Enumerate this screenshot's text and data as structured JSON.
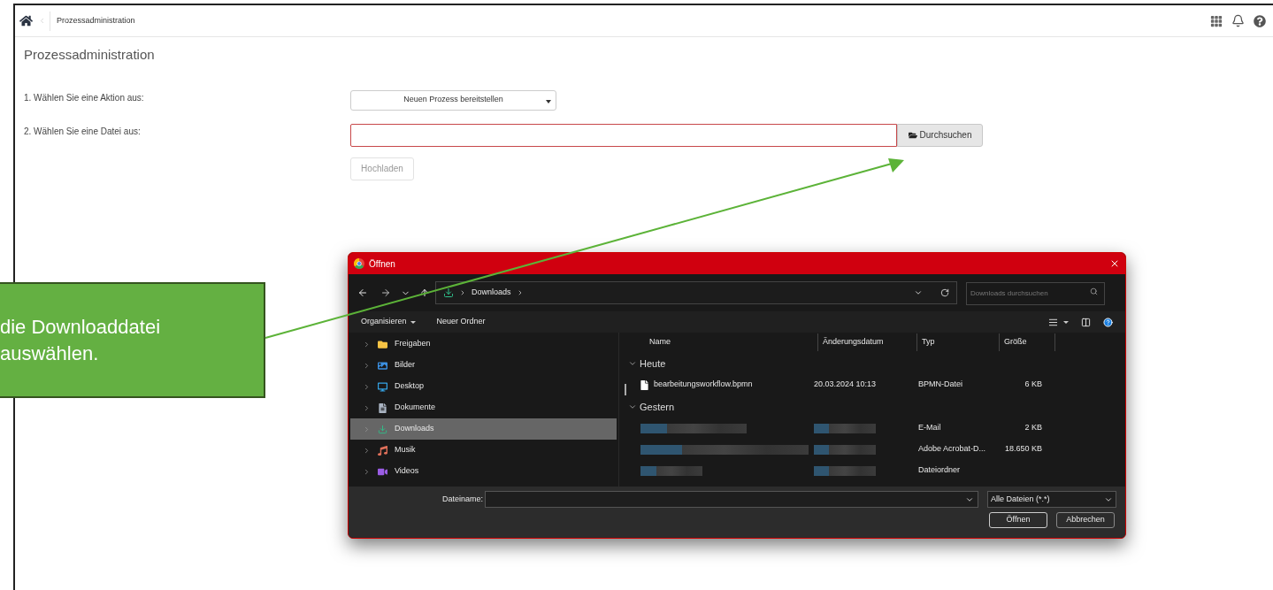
{
  "header": {
    "breadcrumb": "Prozessadministration"
  },
  "page_title": "Prozessadministration",
  "form": {
    "action_label": "1. Wählen Sie eine Aktion aus:",
    "action_value": "Neuen Prozess bereitstellen",
    "file_label": "2. Wählen Sie eine Datei aus:",
    "file_invalid": true,
    "browse_button": "Durchsuchen",
    "upload_button": "Hochladen",
    "upload_disabled": true
  },
  "callout": {
    "text": "die Downloaddatei auswählen."
  },
  "dialog": {
    "title": "Öffnen",
    "path": "Downloads",
    "search": {
      "placeholder": "Downloads durchsuchen"
    },
    "toolbar": [
      "Organisieren",
      "Neuer Ordner"
    ],
    "nav_items": [
      {
        "label": "Freigaben",
        "kind": "folder",
        "selected": false
      },
      {
        "label": "Bilder",
        "kind": "pictures",
        "selected": false
      },
      {
        "label": "Desktop",
        "kind": "desktop",
        "selected": false
      },
      {
        "label": "Dokumente",
        "kind": "documents",
        "selected": false
      },
      {
        "label": "Downloads",
        "kind": "downloads",
        "selected": true
      },
      {
        "label": "Musik",
        "kind": "music",
        "selected": false
      },
      {
        "label": "Videos",
        "kind": "videos",
        "selected": false
      }
    ],
    "columns": [
      "Name",
      "Änderungsdatum",
      "Typ",
      "Größe"
    ],
    "groups": [
      {
        "label": "Heute",
        "rows": [
          {
            "kind": "file",
            "name": "bearbeitungsworkflow.bpmn",
            "date": "20.03.2024 10:13",
            "type": "BPMN-Datei",
            "size": "6 KB"
          }
        ]
      },
      {
        "label": "Gestern",
        "rows": [
          {
            "kind": "redacted",
            "type": "E-Mail",
            "size": "2 KB"
          },
          {
            "kind": "redacted",
            "type": "Adobe Acrobat-D...",
            "size": "18.650 KB"
          },
          {
            "kind": "redacted",
            "type": "Dateiordner"
          }
        ]
      }
    ],
    "filename_label": "Dateiname:",
    "filter": "Alle Dateien (*.*)",
    "open_button": "Öffnen",
    "cancel_button": "Abbrechen"
  }
}
